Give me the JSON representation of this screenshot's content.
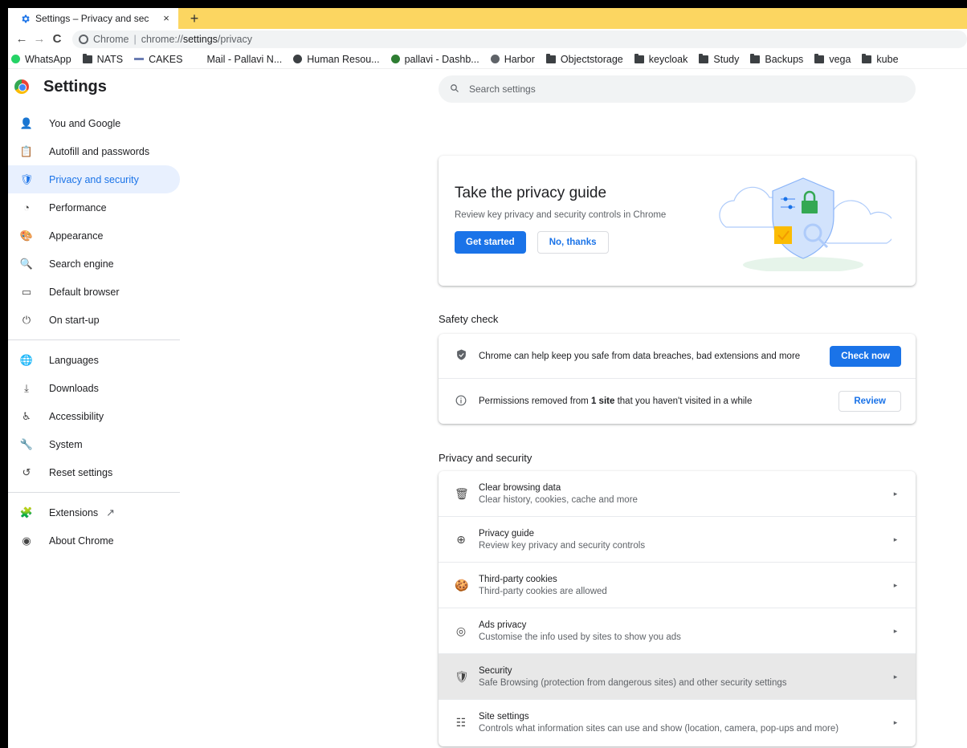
{
  "browser": {
    "tab_title": "Settings – Privacy and sec",
    "tab_close": "×",
    "new_tab": "+",
    "omnibox_chip": "Chrome",
    "omnibox_sep": "|",
    "url_prefix": "chrome://",
    "url_bold": "settings",
    "url_suffix": "/privacy",
    "bookmarks": [
      {
        "label": "WhatsApp",
        "icon": "whatsapp-icon"
      },
      {
        "label": "NATS",
        "icon": "folder-icon"
      },
      {
        "label": "CAKES",
        "icon": "cakes-icon"
      },
      {
        "label": "Mail - Pallavi N...",
        "icon": "mail-icon"
      },
      {
        "label": "Human Resou...",
        "icon": "hr-icon"
      },
      {
        "label": "pallavi - Dashb...",
        "icon": "dashboard-icon"
      },
      {
        "label": "Harbor",
        "icon": "harbor-icon"
      },
      {
        "label": "Objectstorage",
        "icon": "folder-icon"
      },
      {
        "label": "keycloak",
        "icon": "folder-icon"
      },
      {
        "label": "Study",
        "icon": "folder-icon"
      },
      {
        "label": "Backups",
        "icon": "folder-icon"
      },
      {
        "label": "vega",
        "icon": "folder-icon"
      },
      {
        "label": "kube",
        "icon": "folder-icon"
      }
    ]
  },
  "sidebar": {
    "title": "Settings",
    "group1": [
      {
        "label": "You and Google",
        "icon": "person-icon",
        "glyph": "👤"
      },
      {
        "label": "Autofill and passwords",
        "icon": "clipboard-icon",
        "glyph": "📋"
      },
      {
        "label": "Privacy and security",
        "icon": "shield-icon",
        "glyph": "🛡",
        "active": true
      },
      {
        "label": "Performance",
        "icon": "gauge-icon",
        "glyph": "◔"
      },
      {
        "label": "Appearance",
        "icon": "palette-icon",
        "glyph": "🎨"
      },
      {
        "label": "Search engine",
        "icon": "search-icon",
        "glyph": "🔍"
      },
      {
        "label": "Default browser",
        "icon": "browser-icon",
        "glyph": "▭"
      },
      {
        "label": "On start-up",
        "icon": "power-icon",
        "glyph": "⏻"
      }
    ],
    "group2": [
      {
        "label": "Languages",
        "icon": "globe-icon",
        "glyph": "🌐"
      },
      {
        "label": "Downloads",
        "icon": "download-icon",
        "glyph": "⤓"
      },
      {
        "label": "Accessibility",
        "icon": "accessibility-icon",
        "glyph": "♿"
      },
      {
        "label": "System",
        "icon": "wrench-icon",
        "glyph": "🔧"
      },
      {
        "label": "Reset settings",
        "icon": "reset-icon",
        "glyph": "↺"
      }
    ],
    "group3": [
      {
        "label": "Extensions",
        "icon": "puzzle-icon",
        "glyph": "🧩",
        "external": true
      },
      {
        "label": "About Chrome",
        "icon": "chrome-icon",
        "glyph": "◉"
      }
    ]
  },
  "search": {
    "placeholder": "Search settings"
  },
  "guide": {
    "title": "Take the privacy guide",
    "description": "Review key privacy and security controls in Chrome",
    "primary": "Get started",
    "secondary": "No, thanks"
  },
  "safety": {
    "title": "Safety check",
    "row1_text": "Chrome can help keep you safe from data breaches, bad extensions and more",
    "row1_button": "Check now",
    "row2_pre": "Permissions removed from ",
    "row2_bold": "1 site",
    "row2_post": " that you haven't visited in a while",
    "row2_button": "Review"
  },
  "privacy": {
    "title": "Privacy and security",
    "items": [
      {
        "title": "Clear browsing data",
        "sub": "Clear history, cookies, cache and more",
        "icon": "trash-icon",
        "glyph": "🗑"
      },
      {
        "title": "Privacy guide",
        "sub": "Review key privacy and security controls",
        "icon": "compass-icon",
        "glyph": "⊕"
      },
      {
        "title": "Third-party cookies",
        "sub": "Third-party cookies are allowed",
        "icon": "cookie-icon",
        "glyph": "🍪"
      },
      {
        "title": "Ads privacy",
        "sub": "Customise the info used by sites to show you ads",
        "icon": "ads-icon",
        "glyph": "◎"
      },
      {
        "title": "Security",
        "sub": "Safe Browsing (protection from dangerous sites) and other security settings",
        "icon": "shield-icon",
        "glyph": "🛡",
        "highlight": true
      },
      {
        "title": "Site settings",
        "sub": "Controls what information sites can use and show (location, camera, pop-ups and more)",
        "icon": "sliders-icon",
        "glyph": "☷"
      }
    ]
  },
  "colors": {
    "accent": "#1a73e8",
    "tabstrip": "#fcd661",
    "active_nav": "#e8f0fe"
  }
}
